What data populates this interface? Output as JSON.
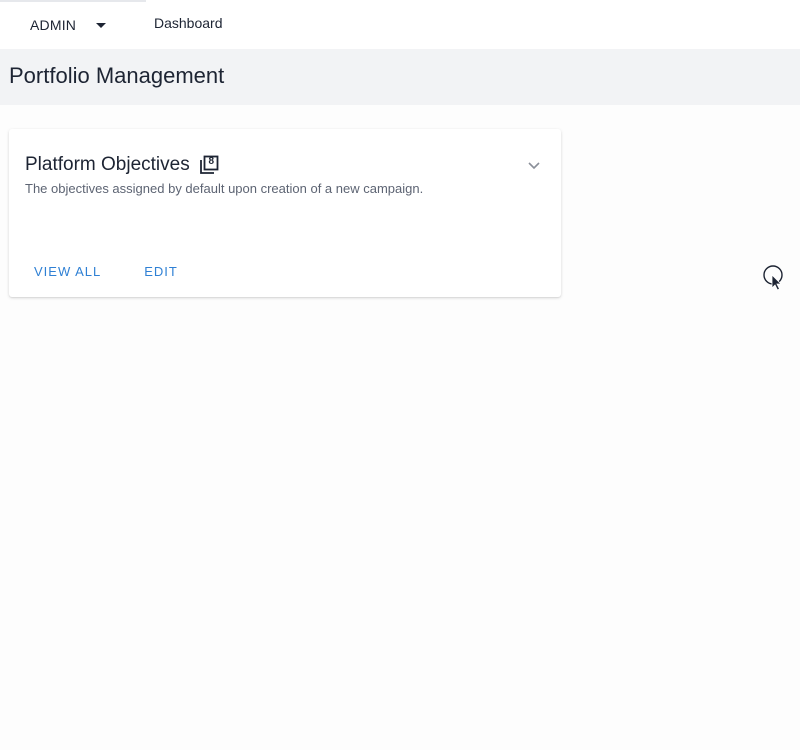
{
  "topbar": {
    "role": "ADMIN",
    "nav_dashboard": "Dashboard"
  },
  "page": {
    "title": "Portfolio Management"
  },
  "card": {
    "title": "Platform Objectives",
    "count": "8",
    "description": "The objectives assigned by default upon creation of a new campaign.",
    "view_all_label": "VIEW ALL",
    "edit_label": "EDIT"
  },
  "colors": {
    "accent": "#2f80d4",
    "text": "#1d2433",
    "muted": "#5d6473",
    "header_bg": "#f2f3f5"
  },
  "icons": {
    "role_dropdown": "caret-down-icon",
    "count": "filter-count-icon",
    "expand": "chevron-down-icon",
    "cursor": "mouse-cursor-icon"
  }
}
